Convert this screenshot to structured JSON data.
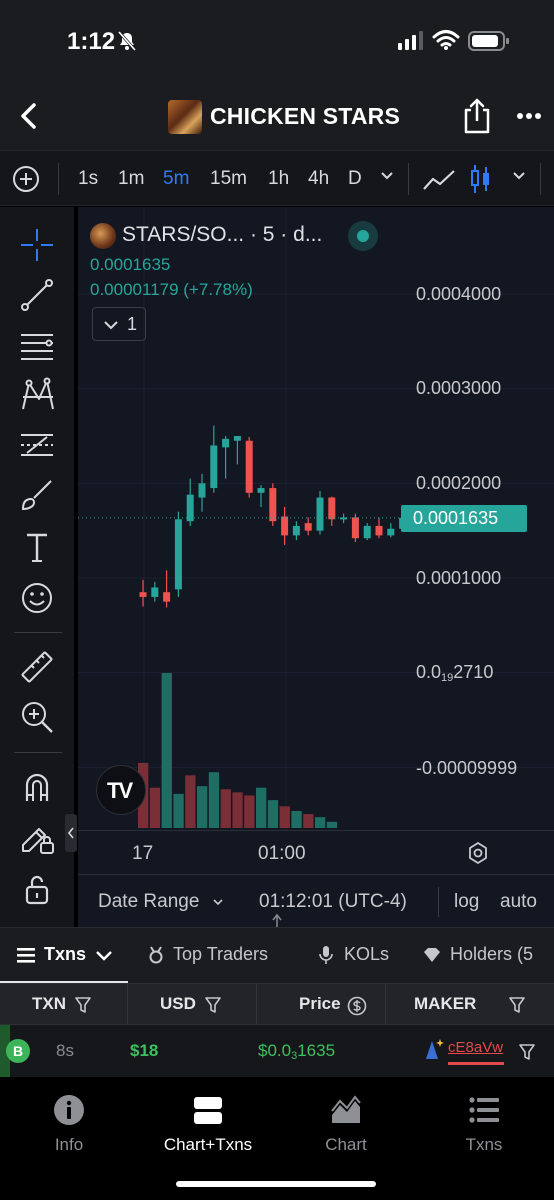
{
  "status_bar": {
    "time": "1:12"
  },
  "header": {
    "title": "CHICKEN STARS"
  },
  "intervals": [
    "1s",
    "1m",
    "5m",
    "15m",
    "1h",
    "4h",
    "D"
  ],
  "active_interval": "5m",
  "chart": {
    "pair_label": "STARS/SO... · 5 · d...",
    "price": "0.0001635",
    "change": "0.00001179 (+7.78%)",
    "indicator_count": "1",
    "y_labels": {
      "l1": "0.0004000",
      "l2": "0.0003000",
      "l3": "0.0002000",
      "l4": "0.0001000",
      "l5_main": "0.0",
      "l5_sub": "19",
      "l5_tail": "2710",
      "l6": "-0.00009999"
    },
    "last_price_tag": "0.0001635",
    "x_labels": [
      "17",
      "01:00"
    ],
    "date_range_label": "Date Range",
    "time_label": "01:12:01 (UTC-4)",
    "log_label": "log",
    "auto_label": "auto",
    "colors": {
      "up": "#26a69a",
      "down": "#ef5350",
      "background": "#131722"
    }
  },
  "chart_data": {
    "type": "candlestick",
    "ylim": [
      -9.999e-05,
      0.0004
    ],
    "candles": [
      {
        "o": 8.5e-05,
        "h": 9.8e-05,
        "l": 7e-05,
        "c": 8e-05
      },
      {
        "o": 8e-05,
        "h": 9.6e-05,
        "l": 7.5e-05,
        "c": 9e-05
      },
      {
        "o": 8.5e-05,
        "h": 0.000108,
        "l": 6.9e-05,
        "c": 7.5e-05
      },
      {
        "o": 8.8e-05,
        "h": 0.00017,
        "l": 8e-05,
        "c": 0.000162
      },
      {
        "o": 0.00016,
        "h": 0.000205,
        "l": 0.000155,
        "c": 0.000188
      },
      {
        "o": 0.000185,
        "h": 0.00021,
        "l": 0.00017,
        "c": 0.0002
      },
      {
        "o": 0.000195,
        "h": 0.000261,
        "l": 0.00019,
        "c": 0.00024
      },
      {
        "o": 0.000238,
        "h": 0.00025,
        "l": 0.000205,
        "c": 0.000247
      },
      {
        "o": 0.000245,
        "h": 0.000248,
        "l": 0.00022,
        "c": 0.00025
      },
      {
        "o": 0.000245,
        "h": 0.000249,
        "l": 0.000185,
        "c": 0.00019
      },
      {
        "o": 0.00019,
        "h": 0.000198,
        "l": 0.000175,
        "c": 0.000195
      },
      {
        "o": 0.000195,
        "h": 0.0002,
        "l": 0.000155,
        "c": 0.00016
      },
      {
        "o": 0.000165,
        "h": 0.000175,
        "l": 0.000135,
        "c": 0.000145
      },
      {
        "o": 0.000145,
        "h": 0.00016,
        "l": 0.00014,
        "c": 0.000155
      },
      {
        "o": 0.000158,
        "h": 0.000164,
        "l": 0.000145,
        "c": 0.00015
      },
      {
        "o": 0.00015,
        "h": 0.000192,
        "l": 0.000146,
        "c": 0.000185
      },
      {
        "o": 0.000185,
        "h": 0.000186,
        "l": 0.000155,
        "c": 0.000162
      },
      {
        "o": 0.000162,
        "h": 0.000168,
        "l": 0.000158,
        "c": 0.000164
      },
      {
        "o": 0.000164,
        "h": 0.000168,
        "l": 0.000138,
        "c": 0.000142
      },
      {
        "o": 0.000142,
        "h": 0.000158,
        "l": 0.00014,
        "c": 0.000155
      },
      {
        "o": 0.000155,
        "h": 0.000164,
        "l": 0.000142,
        "c": 0.000145
      },
      {
        "o": 0.000145,
        "h": 0.000158,
        "l": 0.000143,
        "c": 0.000152
      },
      {
        "o": 0.000152,
        "h": 0.000165,
        "l": 0.00015,
        "c": 0.0001635
      }
    ],
    "volumes": [
      {
        "v": 0.42,
        "up": false
      },
      {
        "v": 0.26,
        "up": false
      },
      {
        "v": 1.0,
        "up": true
      },
      {
        "v": 0.22,
        "up": true
      },
      {
        "v": 0.34,
        "up": false
      },
      {
        "v": 0.27,
        "up": true
      },
      {
        "v": 0.36,
        "up": true
      },
      {
        "v": 0.25,
        "up": false
      },
      {
        "v": 0.23,
        "up": false
      },
      {
        "v": 0.21,
        "up": false
      },
      {
        "v": 0.26,
        "up": true
      },
      {
        "v": 0.18,
        "up": true
      },
      {
        "v": 0.14,
        "up": false
      },
      {
        "v": 0.11,
        "up": true
      },
      {
        "v": 0.09,
        "up": false
      },
      {
        "v": 0.07,
        "up": true
      },
      {
        "v": 0.04,
        "up": true
      }
    ]
  },
  "tabs": [
    {
      "label": "Txns"
    },
    {
      "label": "Top Traders"
    },
    {
      "label": "KOLs"
    },
    {
      "label": "Holders (5"
    }
  ],
  "table": {
    "headers": [
      "TXN",
      "USD",
      "Price",
      "MAKER"
    ],
    "row": {
      "type": "B",
      "age": "8s",
      "usd": "$18",
      "price_main": "$0.0",
      "price_sub": "3",
      "price_tail": "1635",
      "maker": "cE8aVw"
    }
  },
  "bottom_nav": [
    {
      "label": "Info"
    },
    {
      "label": "Chart+Txns"
    },
    {
      "label": "Chart"
    },
    {
      "label": "Txns"
    }
  ]
}
